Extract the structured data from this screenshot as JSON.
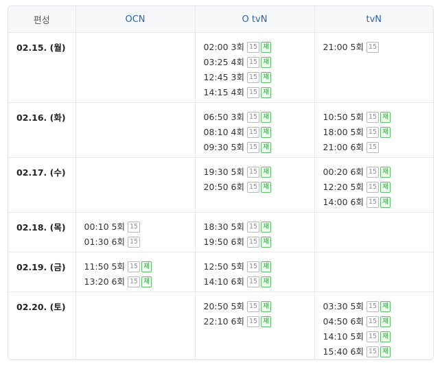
{
  "headers": [
    "편성",
    "OCN",
    "O tvN",
    "tvN"
  ],
  "rows": [
    {
      "date": "02.15. (월)",
      "ocn": [],
      "otvn": [
        {
          "time": "02:00",
          "ep": "3회",
          "rating": "15",
          "rerun": "재"
        },
        {
          "time": "03:25",
          "ep": "4회",
          "rating": "15",
          "rerun": "재"
        },
        {
          "time": "12:45",
          "ep": "3회",
          "rating": "15",
          "rerun": "재"
        },
        {
          "time": "14:15",
          "ep": "4회",
          "rating": "15",
          "rerun": "재"
        }
      ],
      "tvn": [
        {
          "time": "21:00",
          "ep": "5회",
          "rating": "15",
          "rerun": ""
        }
      ]
    },
    {
      "date": "02.16. (화)",
      "ocn": [],
      "otvn": [
        {
          "time": "06:50",
          "ep": "3회",
          "rating": "15",
          "rerun": "재"
        },
        {
          "time": "08:10",
          "ep": "4회",
          "rating": "15",
          "rerun": "재"
        },
        {
          "time": "09:30",
          "ep": "5회",
          "rating": "15",
          "rerun": "재"
        }
      ],
      "tvn": [
        {
          "time": "10:50",
          "ep": "5회",
          "rating": "15",
          "rerun": "재"
        },
        {
          "time": "18:00",
          "ep": "5회",
          "rating": "15",
          "rerun": "재"
        },
        {
          "time": "21:00",
          "ep": "6회",
          "rating": "15",
          "rerun": ""
        }
      ]
    },
    {
      "date": "02.17. (수)",
      "ocn": [],
      "otvn": [
        {
          "time": "19:30",
          "ep": "5회",
          "rating": "15",
          "rerun": "재"
        },
        {
          "time": "20:50",
          "ep": "6회",
          "rating": "15",
          "rerun": "재"
        }
      ],
      "tvn": [
        {
          "time": "00:20",
          "ep": "6회",
          "rating": "15",
          "rerun": "재"
        },
        {
          "time": "12:20",
          "ep": "5회",
          "rating": "15",
          "rerun": "재"
        },
        {
          "time": "14:00",
          "ep": "6회",
          "rating": "15",
          "rerun": "재"
        }
      ]
    },
    {
      "date": "02.18. (목)",
      "ocn": [
        {
          "time": "00:10",
          "ep": "5회",
          "rating": "15",
          "rerun": ""
        },
        {
          "time": "01:30",
          "ep": "6회",
          "rating": "15",
          "rerun": ""
        }
      ],
      "otvn": [
        {
          "time": "18:30",
          "ep": "5회",
          "rating": "15",
          "rerun": "재"
        },
        {
          "time": "19:50",
          "ep": "6회",
          "rating": "15",
          "rerun": "재"
        }
      ],
      "tvn": []
    },
    {
      "date": "02.19. (금)",
      "ocn": [
        {
          "time": "11:50",
          "ep": "5회",
          "rating": "15",
          "rerun": "재"
        },
        {
          "time": "13:20",
          "ep": "6회",
          "rating": "15",
          "rerun": "재"
        }
      ],
      "otvn": [
        {
          "time": "12:50",
          "ep": "5회",
          "rating": "15",
          "rerun": "재"
        },
        {
          "time": "14:10",
          "ep": "6회",
          "rating": "15",
          "rerun": "재"
        }
      ],
      "tvn": []
    },
    {
      "date": "02.20. (토)",
      "ocn": [],
      "otvn": [
        {
          "time": "20:50",
          "ep": "5회",
          "rating": "15",
          "rerun": "재"
        },
        {
          "time": "22:10",
          "ep": "6회",
          "rating": "15",
          "rerun": "재"
        }
      ],
      "tvn": [
        {
          "time": "03:30",
          "ep": "5회",
          "rating": "15",
          "rerun": "재"
        },
        {
          "time": "04:50",
          "ep": "6회",
          "rating": "15",
          "rerun": "재"
        },
        {
          "time": "14:10",
          "ep": "5회",
          "rating": "15",
          "rerun": "재"
        },
        {
          "time": "15:40",
          "ep": "6회",
          "rating": "15",
          "rerun": "재"
        }
      ]
    }
  ]
}
